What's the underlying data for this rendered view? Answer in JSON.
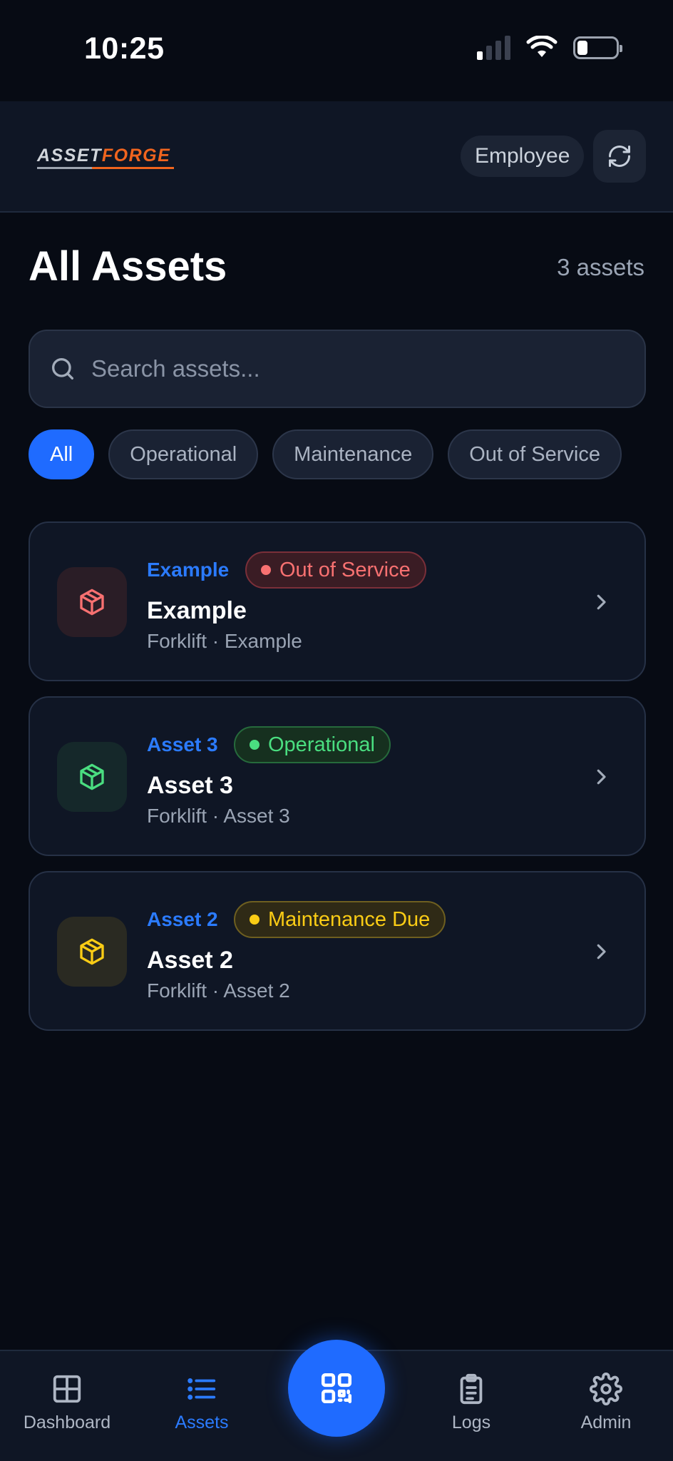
{
  "status_bar": {
    "time": "10:25"
  },
  "header": {
    "logo_part1": "ASSET",
    "logo_part2": "FORGE",
    "role": "Employee"
  },
  "page": {
    "title": "All Assets",
    "count_label": "3 assets"
  },
  "search": {
    "placeholder": "Search assets...",
    "value": ""
  },
  "filters": [
    "All",
    "Operational",
    "Maintenance",
    "Out of Service"
  ],
  "active_filter": "All",
  "assets": [
    {
      "id": "Example",
      "status": "Out of Service",
      "name": "Example",
      "subtitle": "Forklift · Example",
      "color": "#f87171"
    },
    {
      "id": "Asset 3",
      "status": "Operational",
      "name": "Asset 3",
      "subtitle": "Forklift · Asset 3",
      "color": "#4ade80"
    },
    {
      "id": "Asset 2",
      "status": "Maintenance Due",
      "name": "Asset 2",
      "subtitle": "Forklift · Asset 2",
      "color": "#facc15"
    }
  ],
  "nav": {
    "dashboard": "Dashboard",
    "assets": "Assets",
    "logs": "Logs",
    "admin": "Admin"
  },
  "colors": {
    "accent": "#1f6bff",
    "background": "#070b14",
    "surface": "#0f1625"
  },
  "icons": {
    "refresh": "refresh-icon",
    "search": "search-icon",
    "asset": "box-icon",
    "chevron": "chevron-right-icon",
    "dashboard": "grid-icon",
    "assets": "list-icon",
    "scan": "qr-code-icon",
    "logs": "clipboard-icon",
    "admin": "gear-icon"
  }
}
